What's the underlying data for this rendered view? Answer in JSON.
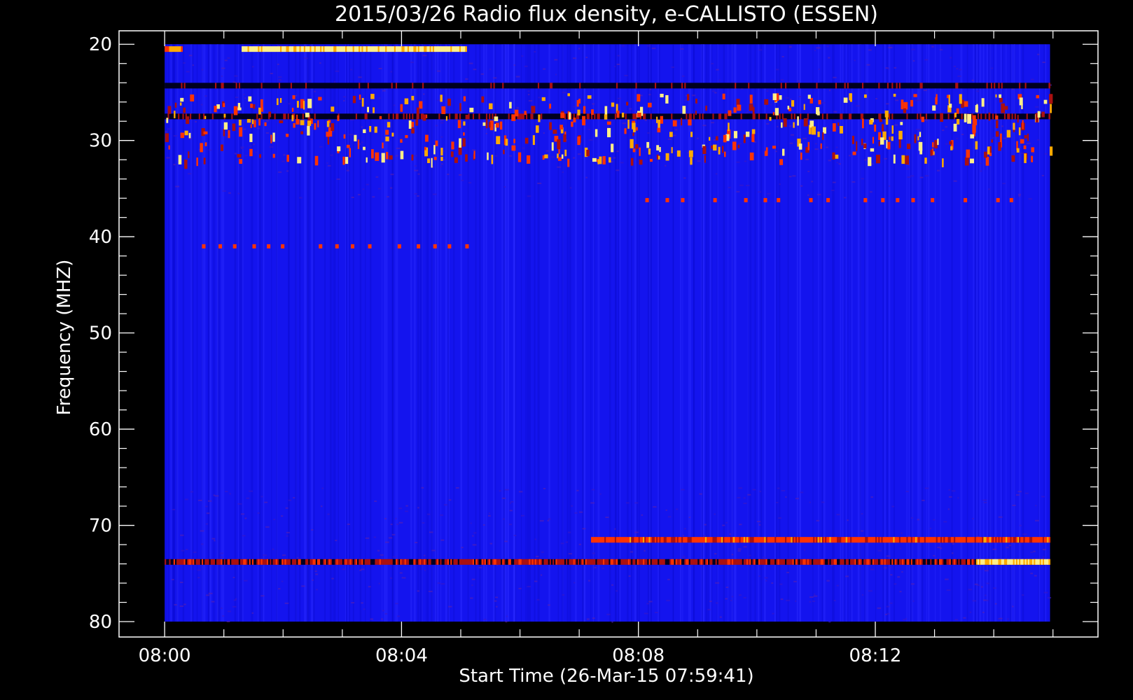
{
  "chart_data": {
    "type": "heatmap",
    "title": "2015/03/26  Radio flux density, e-CALLISTO (ESSEN)",
    "xlabel": "Start Time (26-Mar-15 07:59:41)",
    "ylabel": "Frequency (MHZ)",
    "x_tick_labels": [
      "08:00",
      "08:04",
      "08:08",
      "08:12"
    ],
    "x_ticks_minutes": [
      0,
      4,
      8,
      12
    ],
    "xlim_minutes": [
      -0.77,
      15.76
    ],
    "data_x_range_minutes": [
      0,
      14.95
    ],
    "y_ticks": [
      20,
      30,
      40,
      50,
      60,
      70,
      80
    ],
    "ylim": [
      18.6,
      81.6
    ],
    "data_y_range": [
      20,
      80
    ],
    "y_inverted": true,
    "colormap": [
      "#000000",
      "#0000ff",
      "#aa0000",
      "#ff3300",
      "#ffcc00",
      "#ffffaa"
    ],
    "background_color": "#1414ee",
    "features": [
      {
        "kind": "band",
        "freq": 20.5,
        "t_start": 1.3,
        "t_end": 5.1,
        "intensity": 0.95
      },
      {
        "kind": "band",
        "freq": 20.5,
        "t_start": 0.0,
        "t_end": 0.3,
        "intensity": 0.7
      },
      {
        "kind": "band",
        "freq": 24.3,
        "t_start": 0.0,
        "t_end": 14.95,
        "intensity": 0.05
      },
      {
        "kind": "band",
        "freq": 27.5,
        "t_start": 0.0,
        "t_end": 14.95,
        "intensity": 0.1
      },
      {
        "kind": "bursts",
        "freq_min": 25,
        "freq_max": 32,
        "t_start": 0.0,
        "t_end": 14.95
      },
      {
        "kind": "dots",
        "freq": 41.0,
        "t_start": 0.0,
        "t_end": 5.1
      },
      {
        "kind": "dots",
        "freq": 36.2,
        "t_start": 7.8,
        "t_end": 14.95
      },
      {
        "kind": "band",
        "freq": 71.5,
        "t_start": 7.2,
        "t_end": 14.95,
        "intensity": 0.5
      },
      {
        "kind": "band",
        "freq": 73.8,
        "t_start": 0.0,
        "t_end": 14.95,
        "intensity": 0.3
      },
      {
        "kind": "band",
        "freq": 73.8,
        "t_start": 13.7,
        "t_end": 14.95,
        "intensity": 0.9
      }
    ]
  }
}
